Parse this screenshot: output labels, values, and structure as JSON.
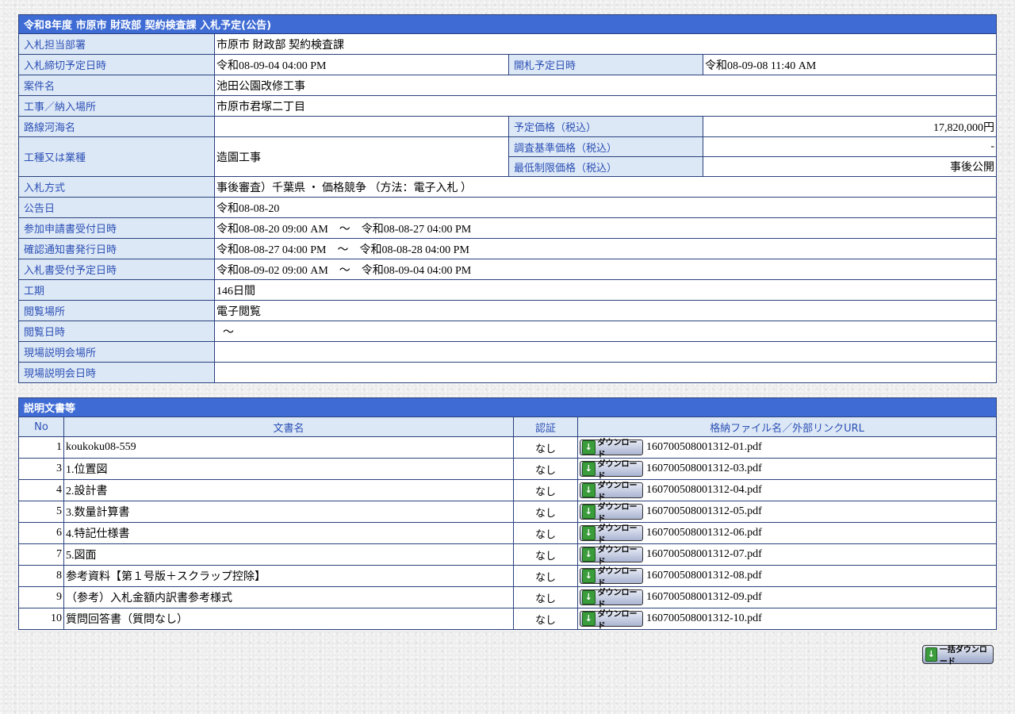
{
  "info": {
    "title": "令和8年度 市原市 財政部 契約検査課 入札予定(公告)",
    "department_label": "入札担当部署",
    "department": "市原市 財政部 契約検査課",
    "deadline_label": "入札締切予定日時",
    "deadline": "令和08-09-04 04:00 PM",
    "opening_label": "開札予定日時",
    "opening": "令和08-09-08 11:40 AM",
    "case_label": "案件名",
    "case": "池田公園改修工事",
    "place_label": "工事／納入場所",
    "place": "市原市君塚二丁目",
    "route_label": "路線河海名",
    "route": "",
    "planned_price_label": "予定価格（税込）",
    "planned_price": "17,820,000円",
    "kind_label": "工種又は業種",
    "kind": "造園工事",
    "survey_price_label": "調査基準価格（税込）",
    "survey_price": "-",
    "min_price_label": "最低制限価格（税込）",
    "min_price": "事後公開",
    "method_label": "入札方式",
    "method": "事後審査）千葉県 ・ 価格競争 （方法：電子入札 ）",
    "notice_date_label": "公告日",
    "notice_date": "令和08-08-20",
    "apply_label": "参加申請書受付日時",
    "apply": "令和08-08-20 09:00 AM　～　令和08-08-27 04:00 PM",
    "confirm_label": "確認通知書発行日時",
    "confirm": "令和08-08-27 04:00 PM　～　令和08-08-28 04:00 PM",
    "bid_accept_label": "入札書受付予定日時",
    "bid_accept": "令和08-09-02 09:00 AM　～　令和08-09-04 04:00 PM",
    "period_label": "工期",
    "period": "146日間",
    "view_place_label": "閲覧場所",
    "view_place": "電子閲覧",
    "view_date_label": "閲覧日時",
    "view_date": "～",
    "briefing_place_label": "現場説明会場所",
    "briefing_place": "",
    "briefing_date_label": "現場説明会日時",
    "briefing_date": ""
  },
  "docs": {
    "title": "説明文書等",
    "headers": {
      "no": "No",
      "name": "文書名",
      "auth": "認証",
      "file": "格納ファイル名／外部リンクURL"
    },
    "download_label": "ダウンロード",
    "rows": [
      {
        "no": "1",
        "name": "koukoku08-559",
        "auth": "なし",
        "file": "160700508001312-01.pdf"
      },
      {
        "no": "3",
        "name": "1.位置図",
        "auth": "なし",
        "file": "160700508001312-03.pdf"
      },
      {
        "no": "4",
        "name": "2.設計書",
        "auth": "なし",
        "file": "160700508001312-04.pdf"
      },
      {
        "no": "5",
        "name": "3.数量計算書",
        "auth": "なし",
        "file": "160700508001312-05.pdf"
      },
      {
        "no": "6",
        "name": "4.特記仕様書",
        "auth": "なし",
        "file": "160700508001312-06.pdf"
      },
      {
        "no": "7",
        "name": "5.図面",
        "auth": "なし",
        "file": "160700508001312-07.pdf"
      },
      {
        "no": "8",
        "name": "参考資料【第１号版＋スクラップ控除】",
        "auth": "なし",
        "file": "160700508001312-08.pdf"
      },
      {
        "no": "9",
        "name": "（参考）入札金額内訳書参考様式",
        "auth": "なし",
        "file": "160700508001312-09.pdf"
      },
      {
        "no": "10",
        "name": "質問回答書（質問なし）",
        "auth": "なし",
        "file": "160700508001312-10.pdf"
      }
    ],
    "bulk_download_label": "一括ダウンロード"
  }
}
